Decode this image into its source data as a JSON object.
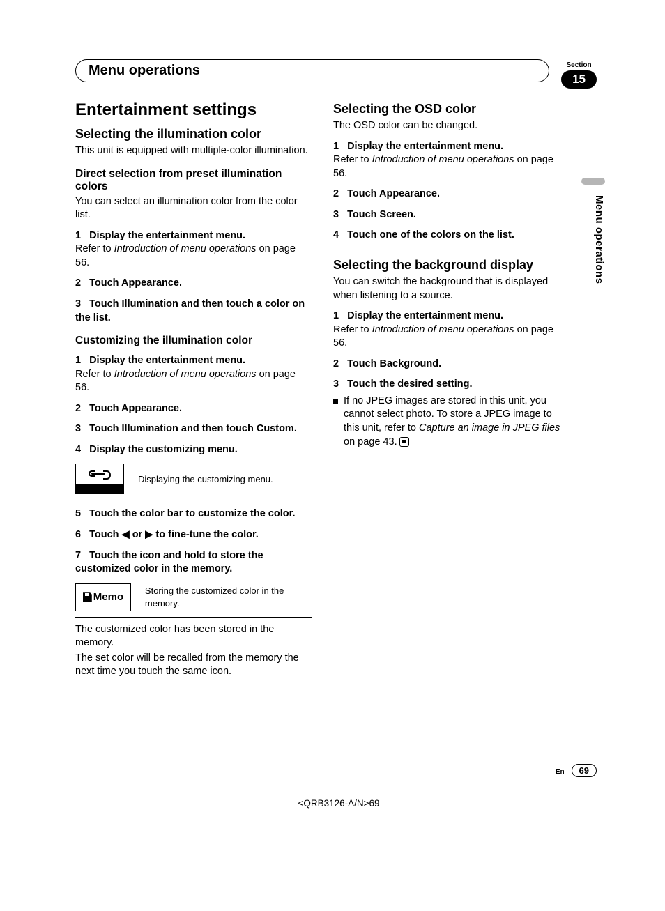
{
  "section": {
    "label": "Section",
    "number": "15"
  },
  "header": {
    "title": "Menu operations"
  },
  "sideTab": "Menu operations",
  "left": {
    "h1": "Entertainment settings",
    "illum": {
      "heading": "Selecting the illumination color",
      "intro": "This unit is equipped with multiple-color illumination.",
      "direct": {
        "heading": "Direct selection from preset illumination colors",
        "intro": "You can select an illumination color from the color list.",
        "steps": {
          "s1": "Display the entertainment menu.",
          "s1ref_a": "Refer to ",
          "s1ref_i": "Introduction of menu operations",
          "s1ref_b": " on page 56.",
          "s2": "Touch Appearance.",
          "s3": "Touch Illumination and then touch a color on the list."
        }
      },
      "custom": {
        "heading": "Customizing the illumination color",
        "s1": "Display the entertainment menu.",
        "s1ref_a": "Refer to ",
        "s1ref_i": "Introduction of menu operations",
        "s1ref_b": " on page 56.",
        "s2": "Touch Appearance.",
        "s3": "Touch Illumination and then touch Custom.",
        "s4": "Display the customizing menu.",
        "s4cap": "Displaying the customizing menu.",
        "s5": "Touch the color bar to customize the color.",
        "s6": "Touch ◀ or ▶ to fine-tune the color.",
        "s7": "Touch the icon and hold to store the customized color in the memory.",
        "memoLabel": "Memo",
        "memoCap": "Storing the customized color in the memory.",
        "after1": "The customized color has been stored in the memory.",
        "after2": "The set color will be recalled from the memory the next time you touch the same icon."
      }
    }
  },
  "right": {
    "osd": {
      "heading": "Selecting the OSD color",
      "intro": "The OSD color can be changed.",
      "s1": "Display the entertainment menu.",
      "s1ref_a": "Refer to ",
      "s1ref_i": "Introduction of menu operations",
      "s1ref_b": " on page 56.",
      "s2": "Touch Appearance.",
      "s3": "Touch Screen.",
      "s4": "Touch one of the colors on the list."
    },
    "bg": {
      "heading": "Selecting the background display",
      "intro": "You can switch the background that is displayed when listening to a source.",
      "s1": "Display the entertainment menu.",
      "s1ref_a": "Refer to ",
      "s1ref_i": "Introduction of menu operations",
      "s1ref_b": " on page 56.",
      "s2": "Touch Background.",
      "s3": "Touch the desired setting.",
      "note_a": "If no JPEG images are stored in this unit, you cannot select photo. To store a JPEG image to this unit, refer to ",
      "note_i": "Capture an image in JPEG files",
      "note_b": " on page 43."
    }
  },
  "footer": {
    "lang": "En",
    "page": "69"
  },
  "docCode": "<QRB3126-A/N>69"
}
